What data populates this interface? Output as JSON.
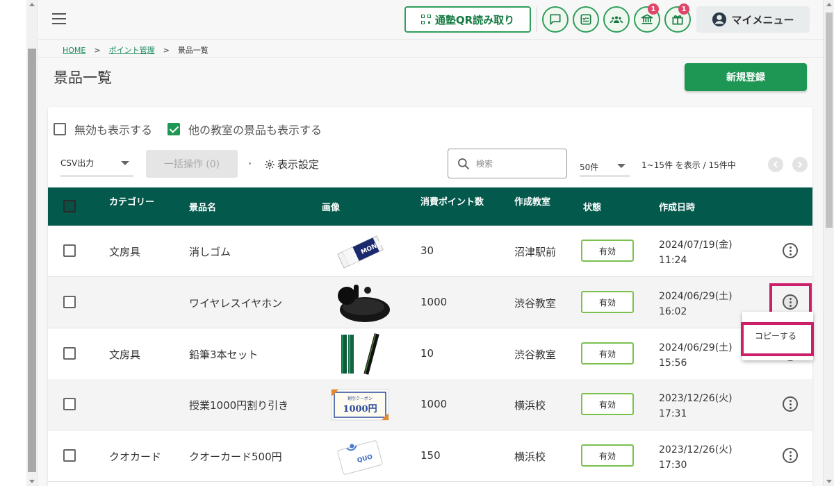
{
  "header": {
    "qr_button_label": "通塾QR読み取り",
    "notification_badge": "1",
    "gift_badge": "1",
    "my_menu_label": "マイメニュー"
  },
  "breadcrumb": {
    "home": "HOME",
    "sep1": ">",
    "points": "ポイント管理",
    "sep2": ">",
    "current": "景品一覧"
  },
  "page": {
    "title": "景品一覧",
    "new_button_label": "新規登録"
  },
  "filters": {
    "show_inactive_label": "無効も表示する",
    "show_inactive_checked": false,
    "show_other_classrooms_label": "他の教室の景品も表示する",
    "show_other_classrooms_checked": true
  },
  "toolbar": {
    "csv_select": "CSV出力",
    "bulk_action_label": "一括操作 (0)",
    "display_settings_label": "表示設定",
    "search_placeholder": "検索",
    "per_page": "50件",
    "range_text": "1~15件 を表示 / 15件中"
  },
  "table": {
    "columns": {
      "category": "カテゴリー",
      "name": "景品名",
      "image": "画像",
      "points": "消費ポイント数",
      "classroom": "作成教室",
      "status": "状態",
      "created": "作成日時"
    },
    "rows": [
      {
        "category": "文房具",
        "name": "消しゴム",
        "image": "eraser-image",
        "points": "30",
        "classroom": "沼津駅前",
        "status": "有効",
        "date": "2024/07/19(金)",
        "time": "11:24"
      },
      {
        "category": "",
        "name": "ワイヤレスイヤホン",
        "image": "earbuds-image",
        "points": "1000",
        "classroom": "渋谷教室",
        "status": "有効",
        "date": "2024/06/29(土)",
        "time": "16:02"
      },
      {
        "category": "文房具",
        "name": "鉛筆3本セット",
        "image": "pencils-image",
        "points": "10",
        "classroom": "渋谷教室",
        "status": "有効",
        "date": "2024/06/29(土)",
        "time": "15:56"
      },
      {
        "category": "",
        "name": "授業1000円割り引き",
        "image": "coupon-image",
        "points": "1000",
        "classroom": "横浜校",
        "status": "有効",
        "date": "2023/12/26(火)",
        "time": "17:31"
      },
      {
        "category": "クオカード",
        "name": "クオーカード500円",
        "image": "quo-card-image",
        "points": "150",
        "classroom": "横浜校",
        "status": "有効",
        "date": "2023/12/26(火)",
        "time": "17:30"
      }
    ]
  },
  "coupon_image_text": {
    "top": "割引クーポン",
    "amount": "1000円"
  },
  "eraser_image_text": "MONO",
  "quo_image_text": "QUO",
  "context_menu": {
    "copy_label": "コピーする"
  },
  "colors": {
    "primary_green": "#1e9654",
    "table_header": "#03594c",
    "status_border": "#7bc14e",
    "highlight": "#cc1f6a",
    "badge": "#e0466a"
  }
}
